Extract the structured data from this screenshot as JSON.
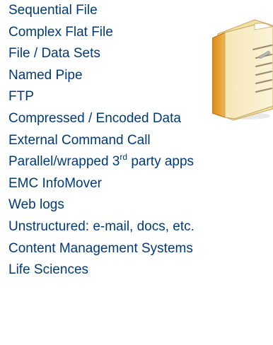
{
  "items": [
    {
      "text": "Sequential File"
    },
    {
      "text": "Complex Flat File"
    },
    {
      "text": "File / Data Sets"
    },
    {
      "text": "Named Pipe"
    },
    {
      "text": "FTP"
    },
    {
      "text": "Compressed / Encoded Data"
    },
    {
      "text": "External Command Call"
    },
    {
      "text": "Parallel/wrapped 3",
      "sup": "rd",
      "after": " party apps"
    },
    {
      "text": "EMC InfoMover"
    },
    {
      "text": "Web logs"
    },
    {
      "text": "Unstructured: e-mail, docs, etc."
    },
    {
      "text": "Content Management Systems"
    },
    {
      "text": "Life Sciences"
    }
  ],
  "colors": {
    "text": "#003a78",
    "background": "#ffffff"
  },
  "icons": {
    "document": "document-icon"
  }
}
